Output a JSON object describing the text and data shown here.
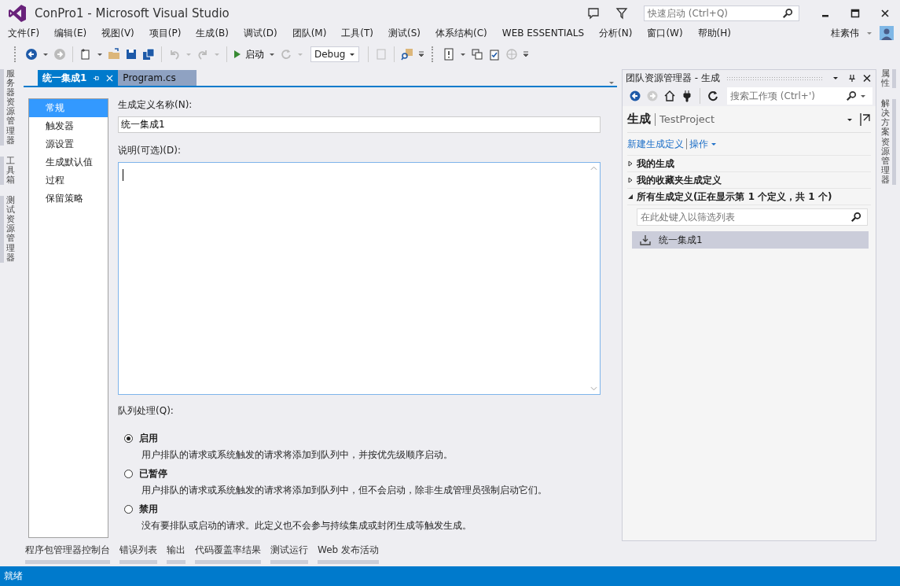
{
  "window": {
    "title": "ConPro1 - Microsoft Visual Studio"
  },
  "quick_launch": {
    "placeholder": "快速启动 (Ctrl+Q)"
  },
  "menu": [
    "文件(F)",
    "编辑(E)",
    "视图(V)",
    "项目(P)",
    "生成(B)",
    "调试(D)",
    "团队(M)",
    "工具(T)",
    "测试(S)",
    "体系结构(C)",
    "WEB ESSENTIALS",
    "分析(N)",
    "窗口(W)",
    "帮助(H)"
  ],
  "account": {
    "user": "桂素伟"
  },
  "toolbar": {
    "start": "启动",
    "configuration": "Debug"
  },
  "left_side_tabs": [
    "服务器资源管理器",
    "工具箱",
    "测试资源管理器"
  ],
  "document_tabs": [
    {
      "label": "统一集成1",
      "selected": true
    },
    {
      "label": "Program.cs",
      "selected": false
    }
  ],
  "build_definition": {
    "nav": [
      {
        "label": "常规",
        "selected": true
      },
      {
        "label": "触发器",
        "selected": false
      },
      {
        "label": "源设置",
        "selected": false
      },
      {
        "label": "生成默认值",
        "selected": false
      },
      {
        "label": "过程",
        "selected": false
      },
      {
        "label": "保留策略",
        "selected": false
      }
    ],
    "name_label": "生成定义名称(N):",
    "name_value": "统一集成1",
    "description_label": "说明(可选)(D):",
    "queue_label": "队列处理(Q):",
    "queue_options": [
      {
        "label": "启用",
        "description": "用户排队的请求或系统触发的请求将添加到队列中，并按优先级顺序启动。",
        "selected": true
      },
      {
        "label": "已暂停",
        "description": "用户排队的请求或系统触发的请求将添加到队列中，但不会启动，除非生成管理员强制启动它们。",
        "selected": false
      },
      {
        "label": "禁用",
        "description": "没有要排队或启动的请求。此定义也不会参与持续集成或封闭生成等触发生成。",
        "selected": false
      }
    ]
  },
  "team_explorer": {
    "title": "团队资源管理器 - 生成",
    "search": {
      "placeholder": "搜索工作项 (Ctrl+')"
    },
    "page": "生成",
    "project": "TestProject",
    "links": [
      "新建生成定义",
      "操作"
    ],
    "sections": [
      {
        "label": "我的生成",
        "expanded": false
      },
      {
        "label": "我的收藏夹生成定义",
        "expanded": false
      },
      {
        "label": "所有生成定义(正在显示第 1 个定义，共 1 个)",
        "expanded": true
      }
    ],
    "filter": {
      "placeholder": "在此处键入以筛选列表"
    },
    "definitions": [
      {
        "label": "统一集成1",
        "selected": true
      }
    ]
  },
  "right_side_tabs": [
    "属性",
    "解决方案资源管理器"
  ],
  "tool_tabs": [
    "程序包管理器控制台",
    "错误列表",
    "输出",
    "代码覆盖率结果",
    "测试运行",
    "Web 发布活动"
  ],
  "status_bar": "就绪"
}
